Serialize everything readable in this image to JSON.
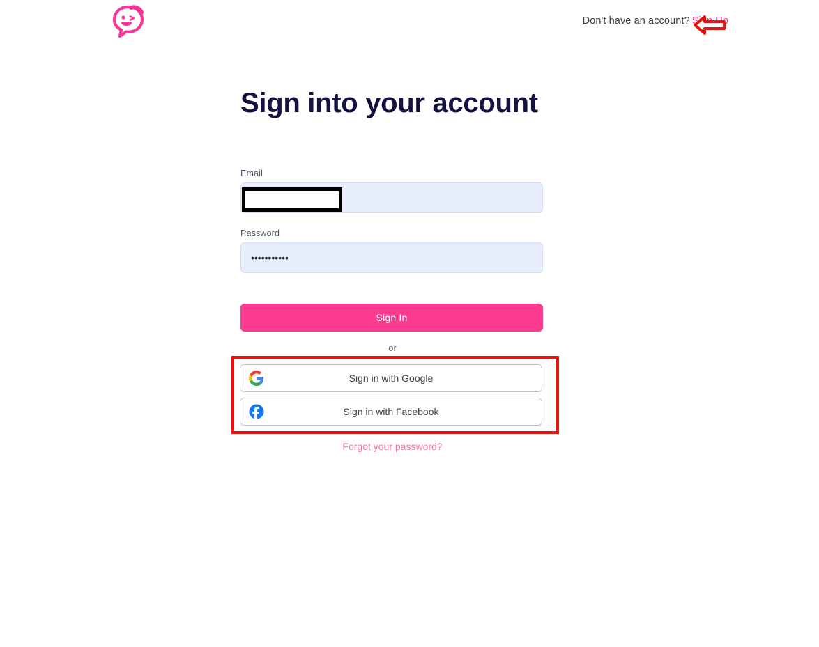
{
  "header": {
    "logo_icon": "chat-face-logo-icon",
    "logo_color": "#f9359a",
    "no_account_text": "Don't have an account?",
    "signup_label": "Sign Up"
  },
  "annotations": {
    "arrow_icon": "left-arrow-annotation-icon",
    "arrow_color": "#e8140f",
    "email_box_color": "#000000",
    "social_box_color": "#e8140f"
  },
  "main": {
    "title": "Sign into your account",
    "fields": {
      "email": {
        "label": "Email",
        "value": "",
        "placeholder": ""
      },
      "password": {
        "label": "Password",
        "value": "...........",
        "placeholder": ""
      }
    },
    "signin_label": "Sign In",
    "divider_label": "or",
    "social_buttons": [
      {
        "label": "Sign in with Google",
        "icon": "google-g-icon"
      },
      {
        "label": "Sign in with Facebook",
        "icon": "facebook-f-icon"
      }
    ],
    "forgot_label": "Forgot your password?"
  },
  "colors": {
    "brand_pink": "#fa3b90",
    "link_pink": "#f93a8f",
    "forgot_pink": "#fb6fa9",
    "title_navy": "#15123f",
    "input_bg": "#e8eefc",
    "annotation_red": "#e8140f"
  }
}
